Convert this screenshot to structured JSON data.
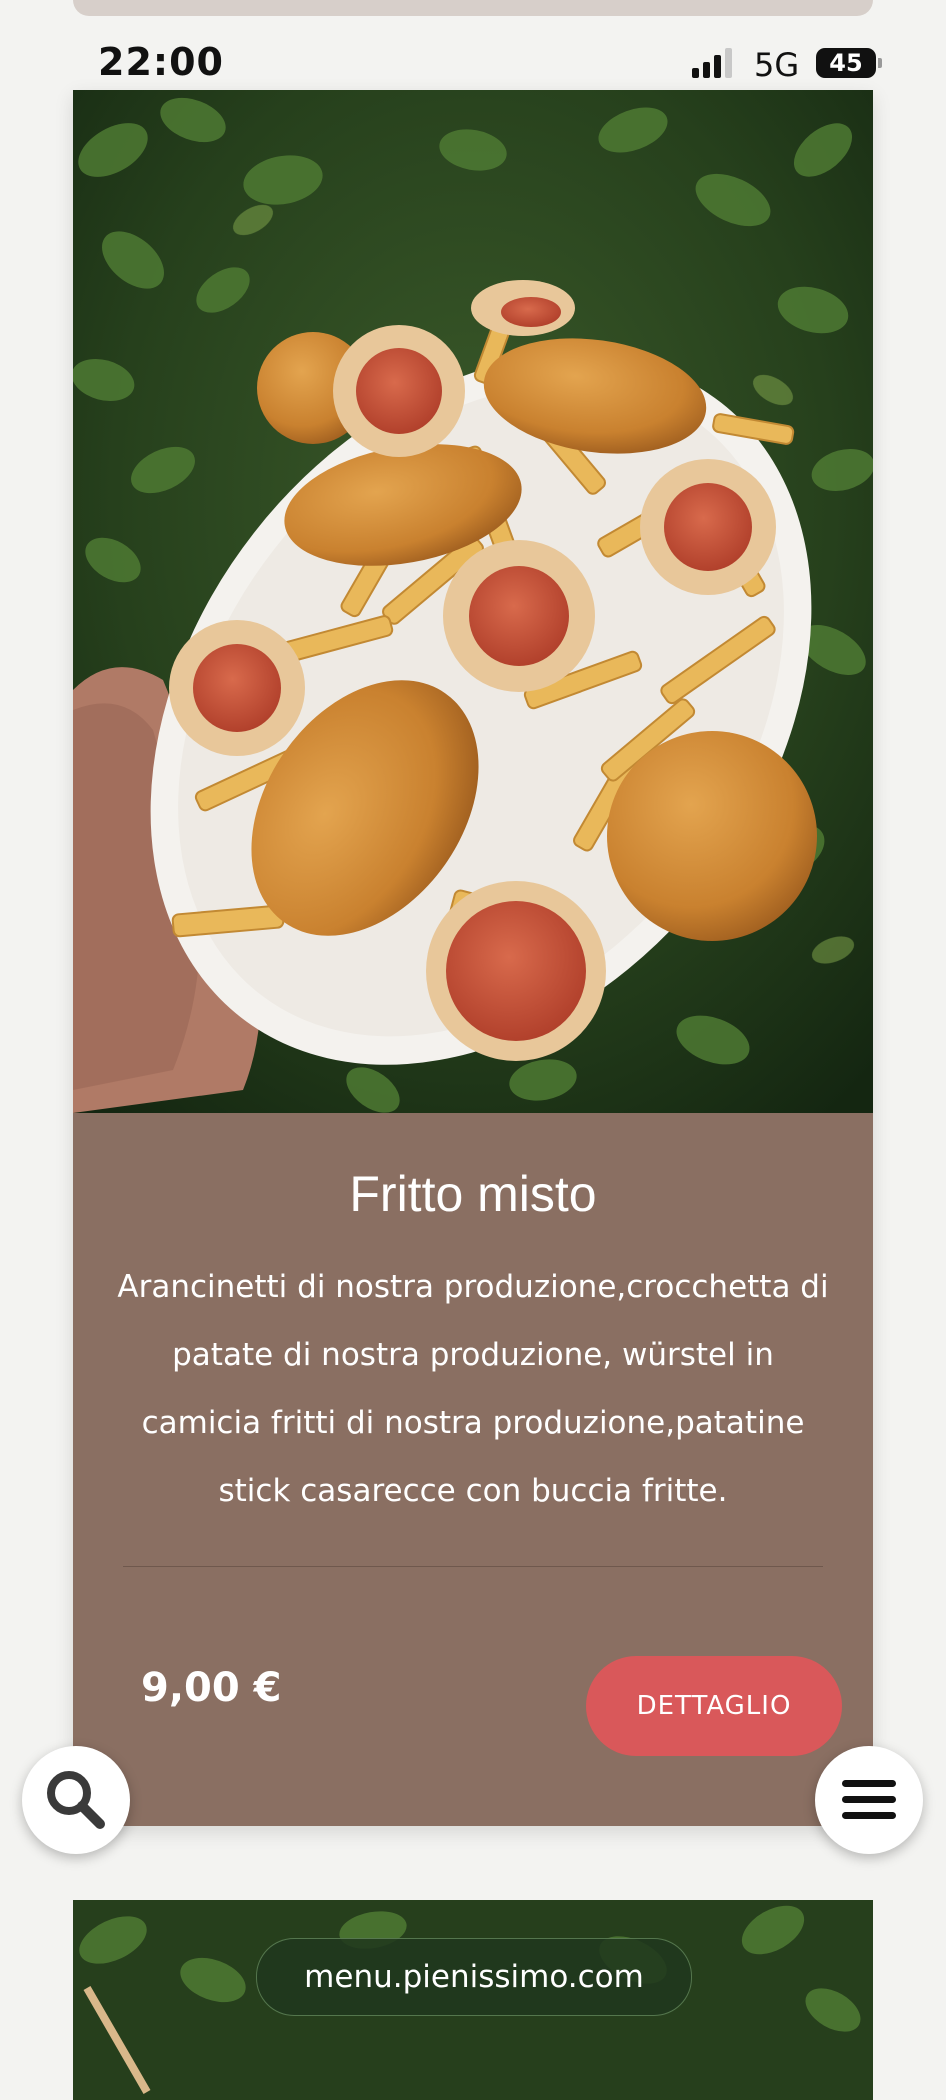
{
  "status_bar": {
    "time": "22:00",
    "network": "5G",
    "battery": "45"
  },
  "product": {
    "image_alt": "Fritto misto dish photo",
    "title": "Fritto misto",
    "description": "Arancinetti di nostra produzione,crocchetta di patate di nostra produzione, würstel in camicia fritti di nostra produzione,patatine stick casarecce con buccia fritte.",
    "price": "9,00 €",
    "detail_label": "DETTAGLIO"
  },
  "floating": {
    "search_icon": "search-icon",
    "menu_icon": "hamburger-menu-icon"
  },
  "url_bar": {
    "url": "menu.pienissimo.com"
  },
  "colors": {
    "card_background": "#8a6f62",
    "button_red": "#d9585a",
    "page_background": "#f3f3f1"
  }
}
